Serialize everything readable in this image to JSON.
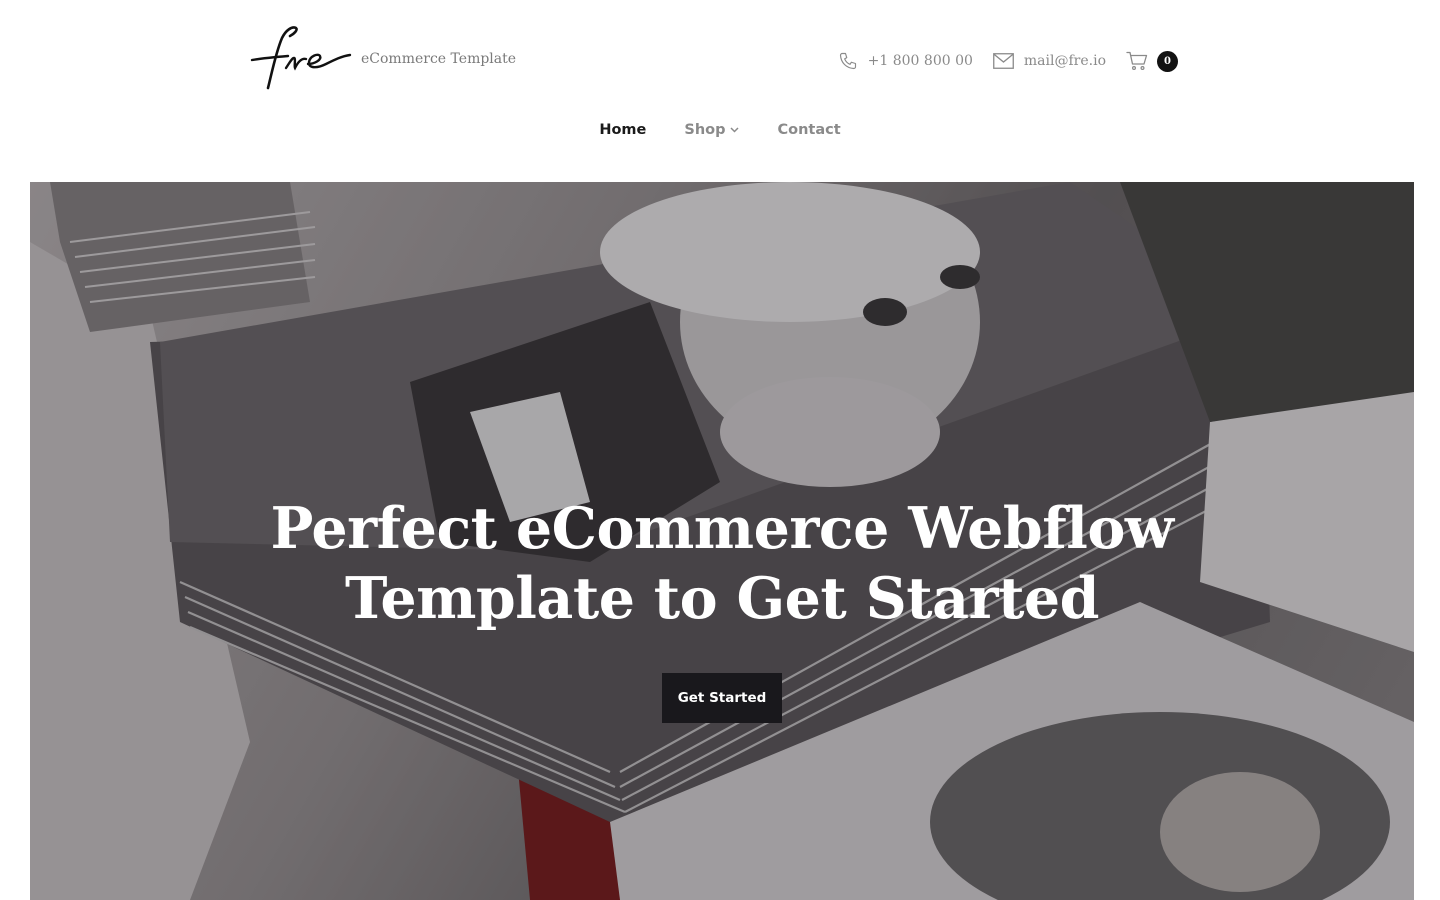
{
  "header": {
    "logo_text": "fre",
    "tagline": "eCommerce Template",
    "phone": "+1 800 800 00",
    "email": "mail@fre.io",
    "cart_count": "0"
  },
  "nav": {
    "items": [
      {
        "label": "Home"
      },
      {
        "label": "Shop"
      },
      {
        "label": "Contact"
      }
    ]
  },
  "hero": {
    "title_line1": "Perfect eCommerce Webflow",
    "title_line2": "Template to Get Started",
    "cta_label": "Get Started"
  },
  "colors": {
    "text_dark": "#1a1a1a",
    "text_muted": "#8a8a8a",
    "button_bg": "#19181c",
    "badge_bg": "#121212"
  },
  "icons": [
    "phone-icon",
    "mail-icon",
    "cart-icon",
    "chevron-down-icon"
  ]
}
